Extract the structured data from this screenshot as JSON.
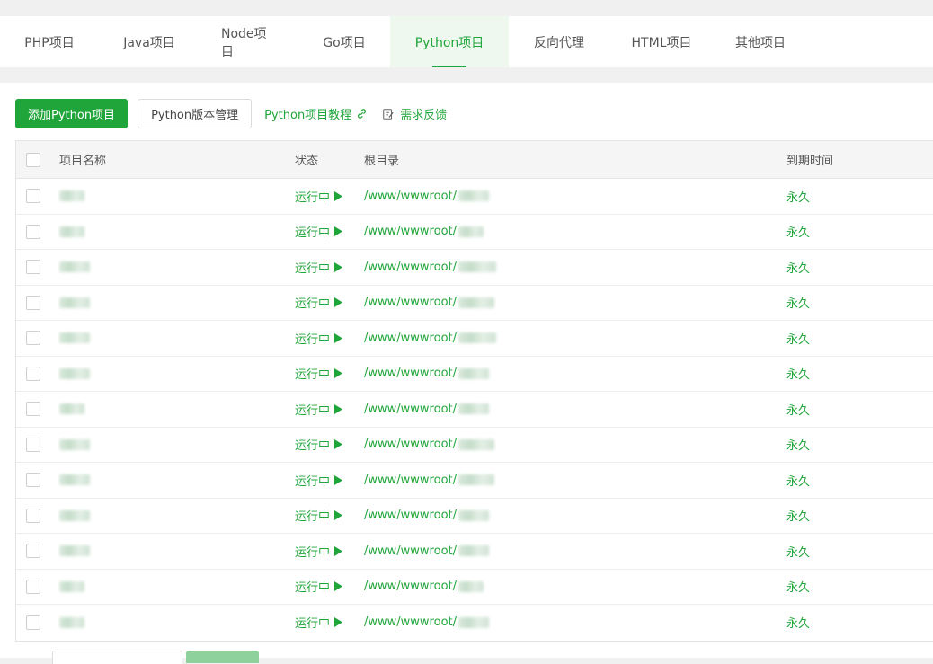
{
  "tabs": [
    {
      "label": "PHP项目",
      "active": false
    },
    {
      "label": "Java项目",
      "active": false
    },
    {
      "label": "Node项目",
      "active": false
    },
    {
      "label": "Go项目",
      "active": false
    },
    {
      "label": "Python项目",
      "active": true
    },
    {
      "label": "反向代理",
      "active": false
    },
    {
      "label": "HTML项目",
      "active": false
    },
    {
      "label": "其他项目",
      "active": false
    }
  ],
  "toolbar": {
    "add_label": "添加Python项目",
    "version_label": "Python版本管理",
    "tutorial_label": "Python项目教程",
    "feedback_label": "需求反馈"
  },
  "table": {
    "headers": {
      "name": "项目名称",
      "status": "状态",
      "root": "根目录",
      "expire": "到期时间"
    },
    "rows": [
      {
        "status": "运行中",
        "root": "/www/wwwroot/",
        "expire": "永久"
      },
      {
        "status": "运行中",
        "root": "/www/wwwroot/",
        "expire": "永久"
      },
      {
        "status": "运行中",
        "root": "/www/wwwroot/",
        "expire": "永久"
      },
      {
        "status": "运行中",
        "root": "/www/wwwroot/",
        "expire": "永久"
      },
      {
        "status": "运行中",
        "root": "/www/wwwroot/",
        "expire": "永久"
      },
      {
        "status": "运行中",
        "root": "/www/wwwroot/",
        "expire": "永久"
      },
      {
        "status": "运行中",
        "root": "/www/wwwroot/",
        "expire": "永久"
      },
      {
        "status": "运行中",
        "root": "/www/wwwroot/",
        "expire": "永久"
      },
      {
        "status": "运行中",
        "root": "/www/wwwroot/",
        "expire": "永久"
      },
      {
        "status": "运行中",
        "root": "/www/wwwroot/",
        "expire": "永久"
      },
      {
        "status": "运行中",
        "root": "/www/wwwroot/",
        "expire": "永久"
      },
      {
        "status": "运行中",
        "root": "/www/wwwroot/",
        "expire": "永久"
      },
      {
        "status": "运行中",
        "root": "/www/wwwroot/",
        "expire": "永久"
      }
    ]
  },
  "colors": {
    "accent": "#20a53a",
    "header_bg": "#f5f5f5"
  },
  "icons": {
    "status": "play-icon",
    "tutorial": "link-icon",
    "feedback": "edit-icon"
  }
}
